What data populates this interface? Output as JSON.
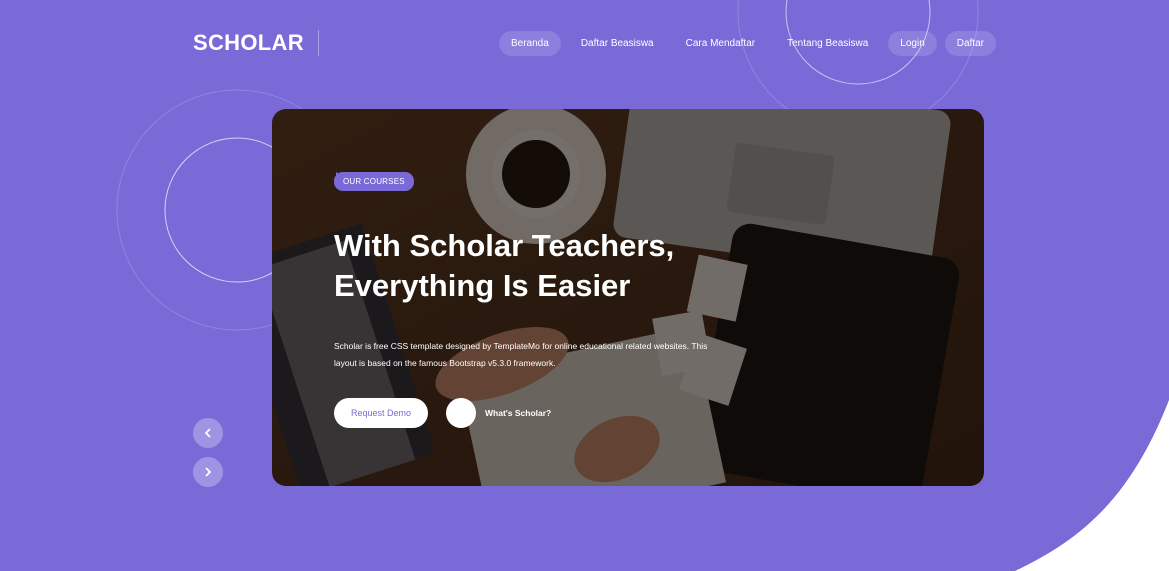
{
  "header": {
    "logo": "SCHOLAR",
    "nav": [
      {
        "label": "Beranda",
        "active": true
      },
      {
        "label": "Daftar Beasiswa",
        "active": false
      },
      {
        "label": "Cara Mendaftar",
        "active": false
      },
      {
        "label": "Tentang Beasiswa",
        "active": false
      },
      {
        "label": "Login",
        "active": false
      },
      {
        "label": "Daftar",
        "active": false
      }
    ]
  },
  "slide": {
    "badge": "OUR COURSES",
    "headline_line1": "With Scholar Teachers,",
    "headline_line2": "Everything Is Easier",
    "description": "Scholar is free CSS template designed by TemplateMo for online educational related websites. This layout is based on the famous Bootstrap v5.3.0 framework.",
    "primary_button": "Request Demo",
    "secondary_button": "What's Scholar?"
  },
  "slider_controls": {
    "prev_icon": "chevron-left-icon",
    "next_icon": "chevron-right-icon"
  },
  "colors": {
    "primary": "#7a6ad8",
    "white": "#ffffff"
  }
}
